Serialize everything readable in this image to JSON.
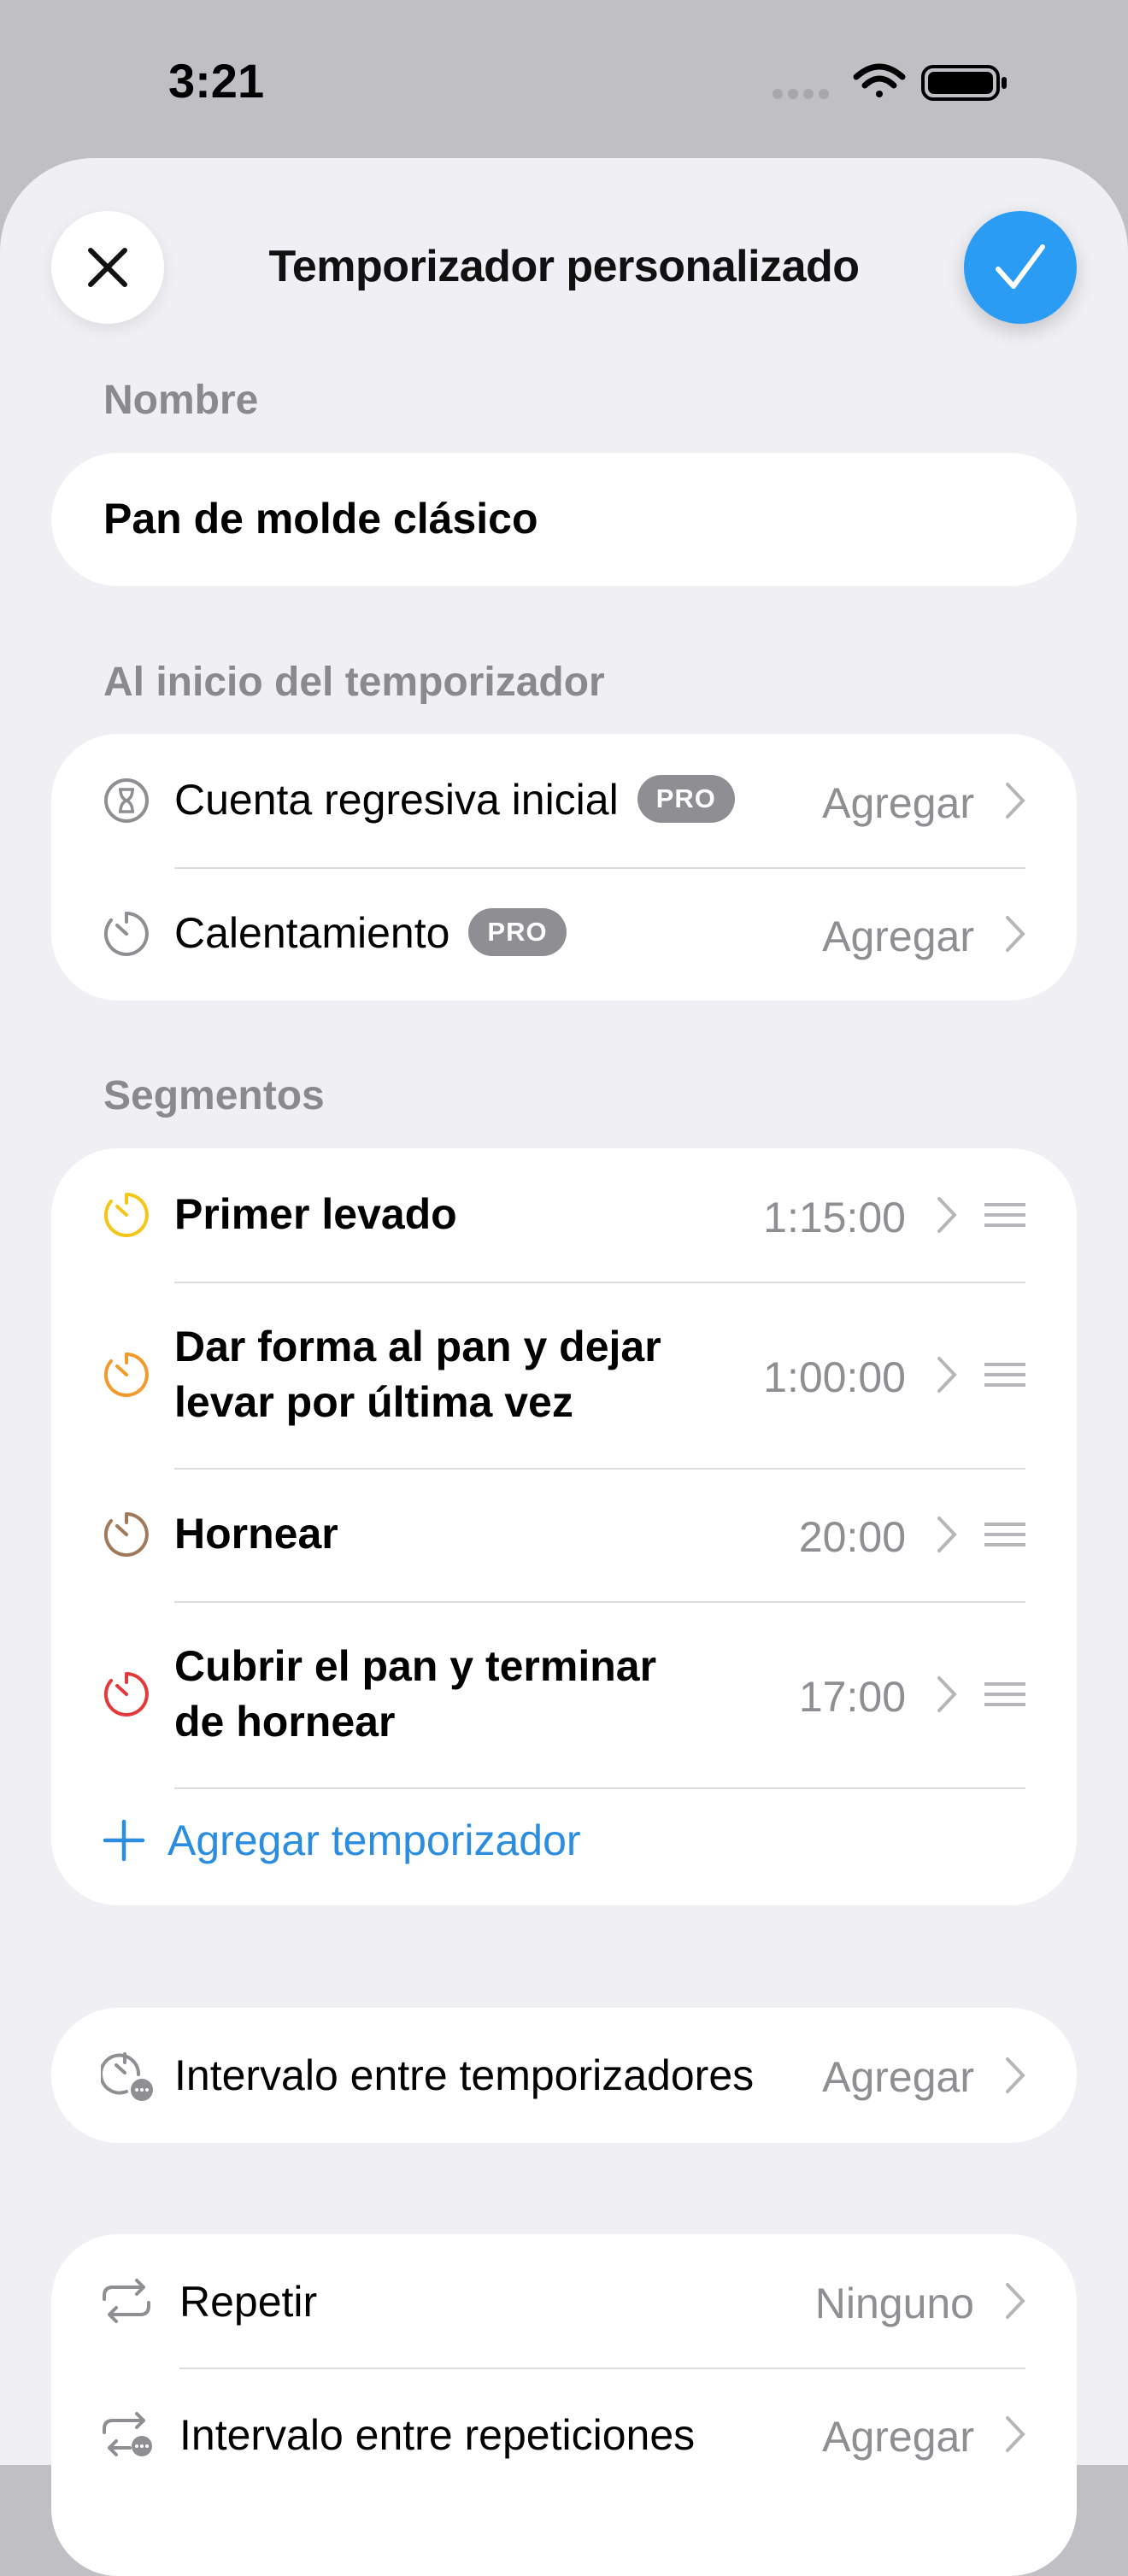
{
  "status_bar": {
    "time": "3:21"
  },
  "header": {
    "title": "Temporizador personalizado"
  },
  "name_section": {
    "label": "Nombre",
    "value": "Pan de molde clásico"
  },
  "start_section": {
    "label": "Al inicio del temporizador",
    "rows": [
      {
        "label": "Cuenta regresiva inicial",
        "badge": "PRO",
        "value": "Agregar",
        "icon": "hourglass-icon"
      },
      {
        "label": "Calentamiento",
        "badge": "PRO",
        "value": "Agregar",
        "icon": "timer-icon"
      }
    ]
  },
  "segments_section": {
    "label": "Segmentos",
    "items": [
      {
        "label": "Primer levado",
        "time": "1:15:00",
        "color": "#f5c518",
        "icon": "timer-icon"
      },
      {
        "label_line1": "Dar forma al pan y dejar",
        "label_line2": "levar por última vez",
        "time": "1:00:00",
        "color": "#f39a2c",
        "icon": "timer-icon"
      },
      {
        "label": "Hornear",
        "time": "20:00",
        "color": "#a0785a",
        "icon": "timer-icon"
      },
      {
        "label_line1": "Cubrir el pan y terminar",
        "label_line2": "de hornear",
        "time": "17:00",
        "color": "#e5383b",
        "icon": "timer-icon"
      }
    ],
    "add_label": "Agregar temporizador"
  },
  "interval_section": {
    "label": "Intervalo entre temporizadores",
    "value": "Agregar",
    "icon": "timer-interval-icon"
  },
  "repeat_section": {
    "rows": [
      {
        "label": "Repetir",
        "value": "Ninguno",
        "icon": "repeat-icon"
      },
      {
        "label": "Intervalo entre repeticiones",
        "value": "Agregar",
        "icon": "repeat-interval-icon"
      }
    ]
  },
  "colors": {
    "accent": "#2a9cf4",
    "link": "#2a8de0",
    "secondary_text": "#8e8e93",
    "badge": "#8e8e93"
  }
}
